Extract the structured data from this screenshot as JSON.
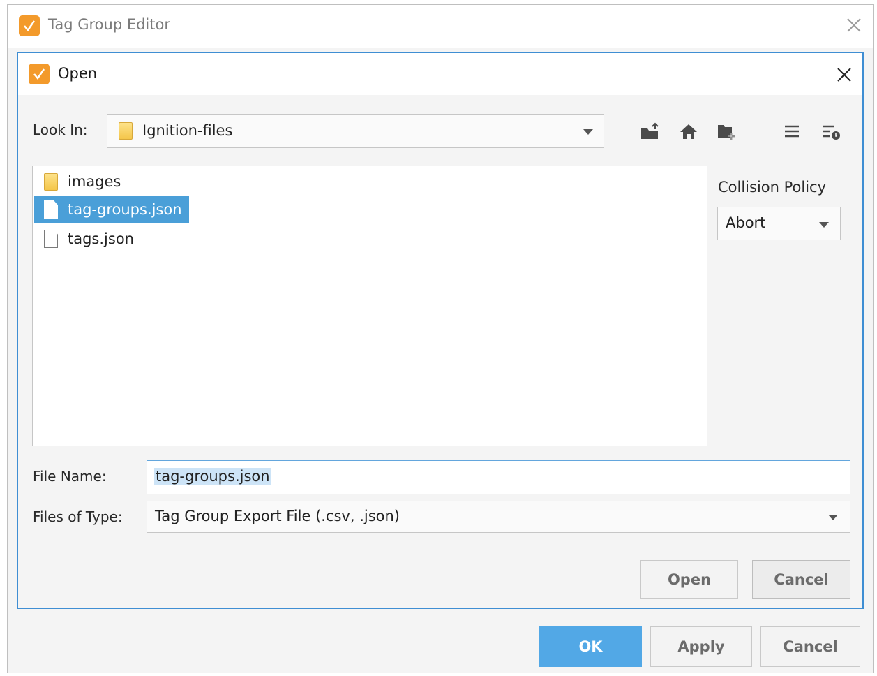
{
  "outer_window": {
    "title": "Tag Group Editor",
    "buttons": {
      "ok": "OK",
      "apply": "Apply",
      "cancel": "Cancel"
    }
  },
  "dialog": {
    "title": "Open",
    "look_in": {
      "label": "Look In:",
      "value": "Ignition-files"
    },
    "toolbar": {
      "icons": [
        "up-folder-icon",
        "home-icon",
        "new-folder-icon",
        "list-view-icon",
        "details-view-icon"
      ]
    },
    "files": [
      {
        "name": "images",
        "type": "folder",
        "selected": false
      },
      {
        "name": "tag-groups.json",
        "type": "file",
        "selected": true
      },
      {
        "name": "tags.json",
        "type": "file",
        "selected": false
      }
    ],
    "collision_policy": {
      "label": "Collision Policy",
      "value": "Abort"
    },
    "file_name": {
      "label": "File Name:",
      "value": "tag-groups.json"
    },
    "files_of_type": {
      "label": "Files of Type:",
      "value": "Tag Group Export File (.csv, .json)"
    },
    "buttons": {
      "open": "Open",
      "cancel": "Cancel"
    }
  },
  "colors": {
    "accent": "#3f8ed3",
    "selection": "#4a9fd8",
    "primary_button": "#52a8e6",
    "app_icon": "#f39a2b"
  }
}
